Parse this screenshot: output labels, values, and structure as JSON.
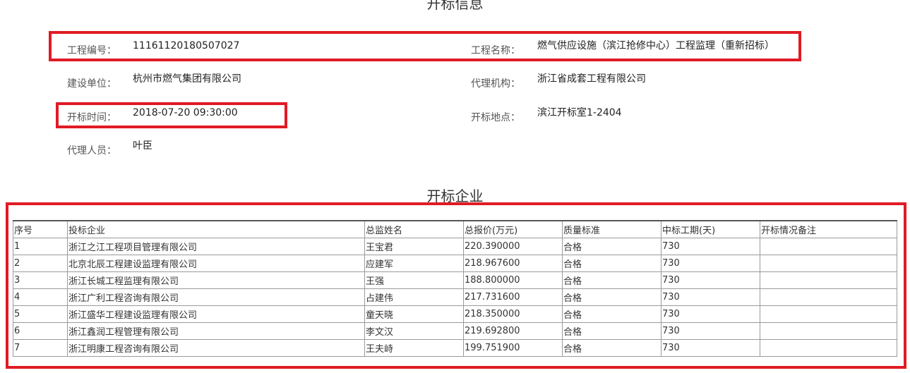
{
  "info": {
    "title": "开标信息",
    "project_no": {
      "label": "工程编号：",
      "value": "11161120180507027"
    },
    "project_name": {
      "label": "工程名称：",
      "value": "燃气供应设施（滨江抢修中心）工程监理（重新招标）"
    },
    "builder": {
      "label": "建设单位：",
      "value": "杭州市燃气集团有限公司"
    },
    "agency": {
      "label": "代理机构：",
      "value": "浙江省成套工程有限公司"
    },
    "open_time": {
      "label": "开标时间：",
      "value": "2018-07-20 09:30:00"
    },
    "open_place": {
      "label": "开标地点：",
      "value": "滨江开标室1-2404"
    },
    "agent_person": {
      "label": "代理人员：",
      "value": "叶臣"
    }
  },
  "companies": {
    "title": "开标企业",
    "headers": [
      "序号",
      "投标企业",
      "总监姓名",
      "总报价(万元)",
      "质量标准",
      "中标工期(天)",
      "开标情况备注"
    ],
    "rows": [
      [
        "1",
        "浙江之江工程项目管理有限公司",
        "王宝君",
        "220.390000",
        "合格",
        "730",
        ""
      ],
      [
        "2",
        "北京北辰工程建设监理有限公司",
        "应建军",
        "218.967600",
        "合格",
        "730",
        ""
      ],
      [
        "3",
        "浙江长城工程监理有限公司",
        "王强",
        "188.800000",
        "合格",
        "730",
        ""
      ],
      [
        "4",
        "浙江广利工程咨询有限公司",
        "占建伟",
        "217.731600",
        "合格",
        "730",
        ""
      ],
      [
        "5",
        "浙江盛华工程建设监理有限公司",
        "童天晓",
        "218.350000",
        "合格",
        "730",
        ""
      ],
      [
        "6",
        "浙江鑫润工程管理有限公司",
        "李文汉",
        "219.692800",
        "合格",
        "730",
        ""
      ],
      [
        "7",
        "浙江明康工程咨询有限公司",
        "王夫峙",
        "199.751900",
        "合格",
        "730",
        ""
      ]
    ]
  },
  "colors": {
    "highlight": "#e01b24",
    "text": "#333333"
  }
}
